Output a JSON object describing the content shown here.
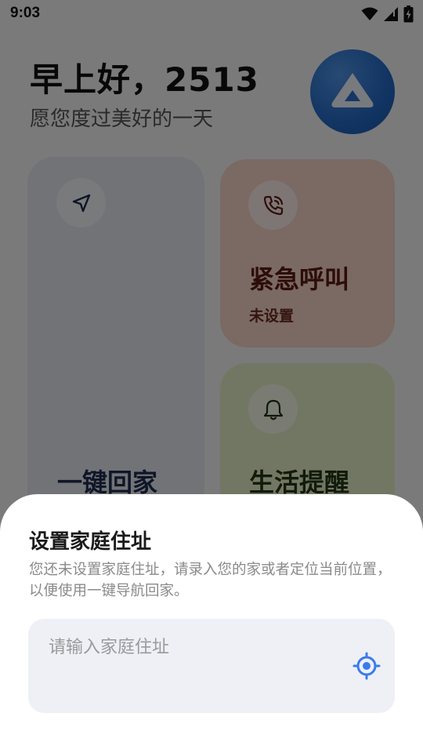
{
  "status_bar": {
    "time": "9:03",
    "icons": [
      "wifi-icon",
      "signal-icon",
      "battery-charging-icon"
    ]
  },
  "header": {
    "greeting": "早上好，2513",
    "subtitle": "愿您度过美好的一天",
    "logo_icon": "app-logo-icon"
  },
  "cards": {
    "home": {
      "title": "一键回家",
      "icon": "navigation-arrow-icon",
      "color": "#e2e7ef"
    },
    "emergency": {
      "title": "紧急呼叫",
      "status": "未设置",
      "icon": "phone-call-icon",
      "color": "#f7d2c6"
    },
    "reminder": {
      "title": "生活提醒",
      "icon": "bell-icon",
      "color": "#e5efc6"
    }
  },
  "address_sheet": {
    "title": "设置家庭住址",
    "description": "您还未设置家庭住址，请录入您的家或者定位当前位置，以便使用一键导航回家。",
    "input_value": "",
    "input_placeholder": "请输入家庭住址",
    "locate_icon": "locate-icon",
    "accent": "#3a7bec"
  }
}
